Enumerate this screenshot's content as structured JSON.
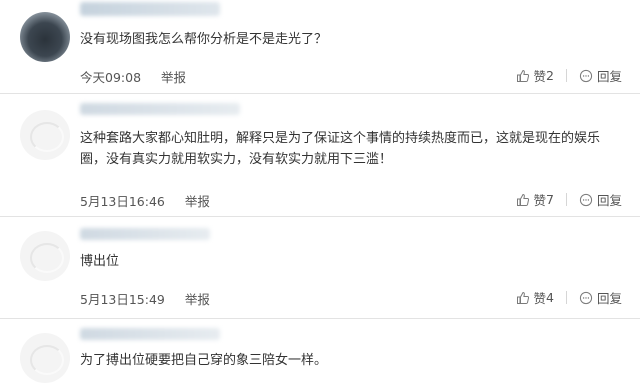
{
  "labels": {
    "like": "赞",
    "reply": "回复",
    "report": "举报"
  },
  "comments": [
    {
      "name": " ",
      "text": "没有现场图我怎么帮你分析是不是走光了？",
      "time": "今天09:08",
      "likes": "2"
    },
    {
      "name": " ",
      "text": "这种套路大家都心知肚明，解释只是为了保证这个事情的持续热度而已，这就是现在的娱乐圈，没有真实力就用软实力，没有软实力就用下三滥！",
      "time": "5月13日16:46",
      "likes": "7"
    },
    {
      "name": " ",
      "text": "博出位",
      "time": "5月13日15:49",
      "likes": "4"
    },
    {
      "name": " ",
      "text": "为了搏出位硬要把自己穿的象三陪女一样。"
    }
  ]
}
